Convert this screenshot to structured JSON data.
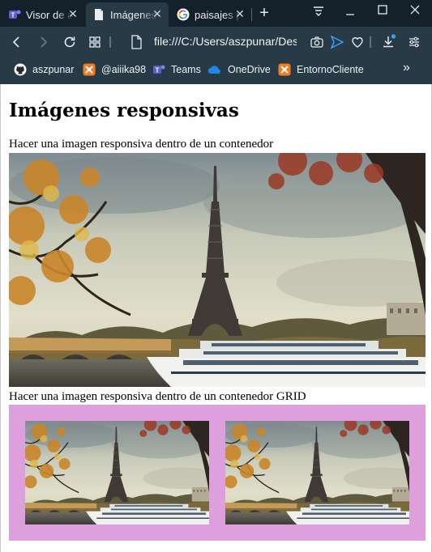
{
  "browser": {
    "tabs": [
      {
        "title": "Visor de archivos",
        "icon": "teams-icon",
        "active": false
      },
      {
        "title": "Imágenes responsivas",
        "icon": "document-icon",
        "active": true
      },
      {
        "title": "paisajes paris",
        "icon": "google-icon",
        "active": false
      }
    ],
    "address": "file:///C:/Users/aszpunar/Desktop",
    "bookmarks": [
      {
        "label": "aszpunar",
        "icon": "github-icon"
      },
      {
        "label": "@aiiika98",
        "icon": "xampp-icon"
      },
      {
        "label": "Teams",
        "icon": "teams-icon"
      },
      {
        "label": "OneDrive",
        "icon": "onedrive-icon"
      },
      {
        "label": "EntornoCliente",
        "icon": "xampp-icon"
      }
    ],
    "overflow_label": "»"
  },
  "page": {
    "heading": "Imágenes responsivas",
    "caption_container": "Hacer una imagen responsiva dentro de un contenedor",
    "caption_grid": "Hacer una imagen responsiva dentro de un contenedor GRID",
    "grid_background": "#dda0dd"
  }
}
